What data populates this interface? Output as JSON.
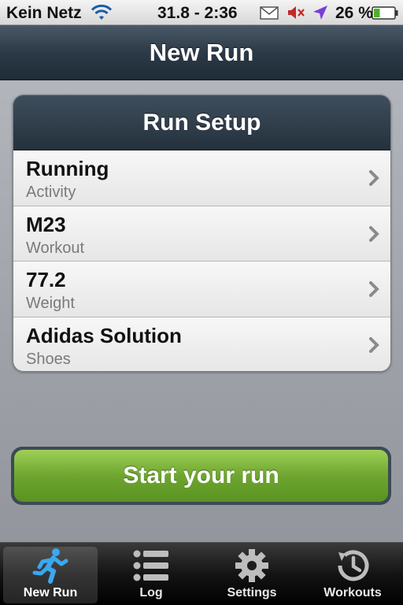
{
  "status_bar": {
    "carrier": "Kein Netz",
    "time": "31.8 - 2:36",
    "battery_percent": "26 %"
  },
  "nav": {
    "title": "New Run"
  },
  "setup": {
    "title": "Run Setup",
    "rows": [
      {
        "value": "Running",
        "label": "Activity"
      },
      {
        "value": "M23",
        "label": "Workout"
      },
      {
        "value": "77.2",
        "label": "Weight"
      },
      {
        "value": "Adidas Solution",
        "label": "Shoes"
      }
    ]
  },
  "start_button": {
    "label": "Start your run"
  },
  "tabs": [
    {
      "label": "New Run",
      "icon": "runner-icon",
      "active": true
    },
    {
      "label": "Log",
      "icon": "list-icon",
      "active": false
    },
    {
      "label": "Settings",
      "icon": "gear-icon",
      "active": false
    },
    {
      "label": "Workouts",
      "icon": "history-icon",
      "active": false
    }
  ],
  "colors": {
    "accent_green": "#6ea52f",
    "nav_dark": "#2c3a47",
    "active_tab_blue": "#3aa8f0"
  }
}
